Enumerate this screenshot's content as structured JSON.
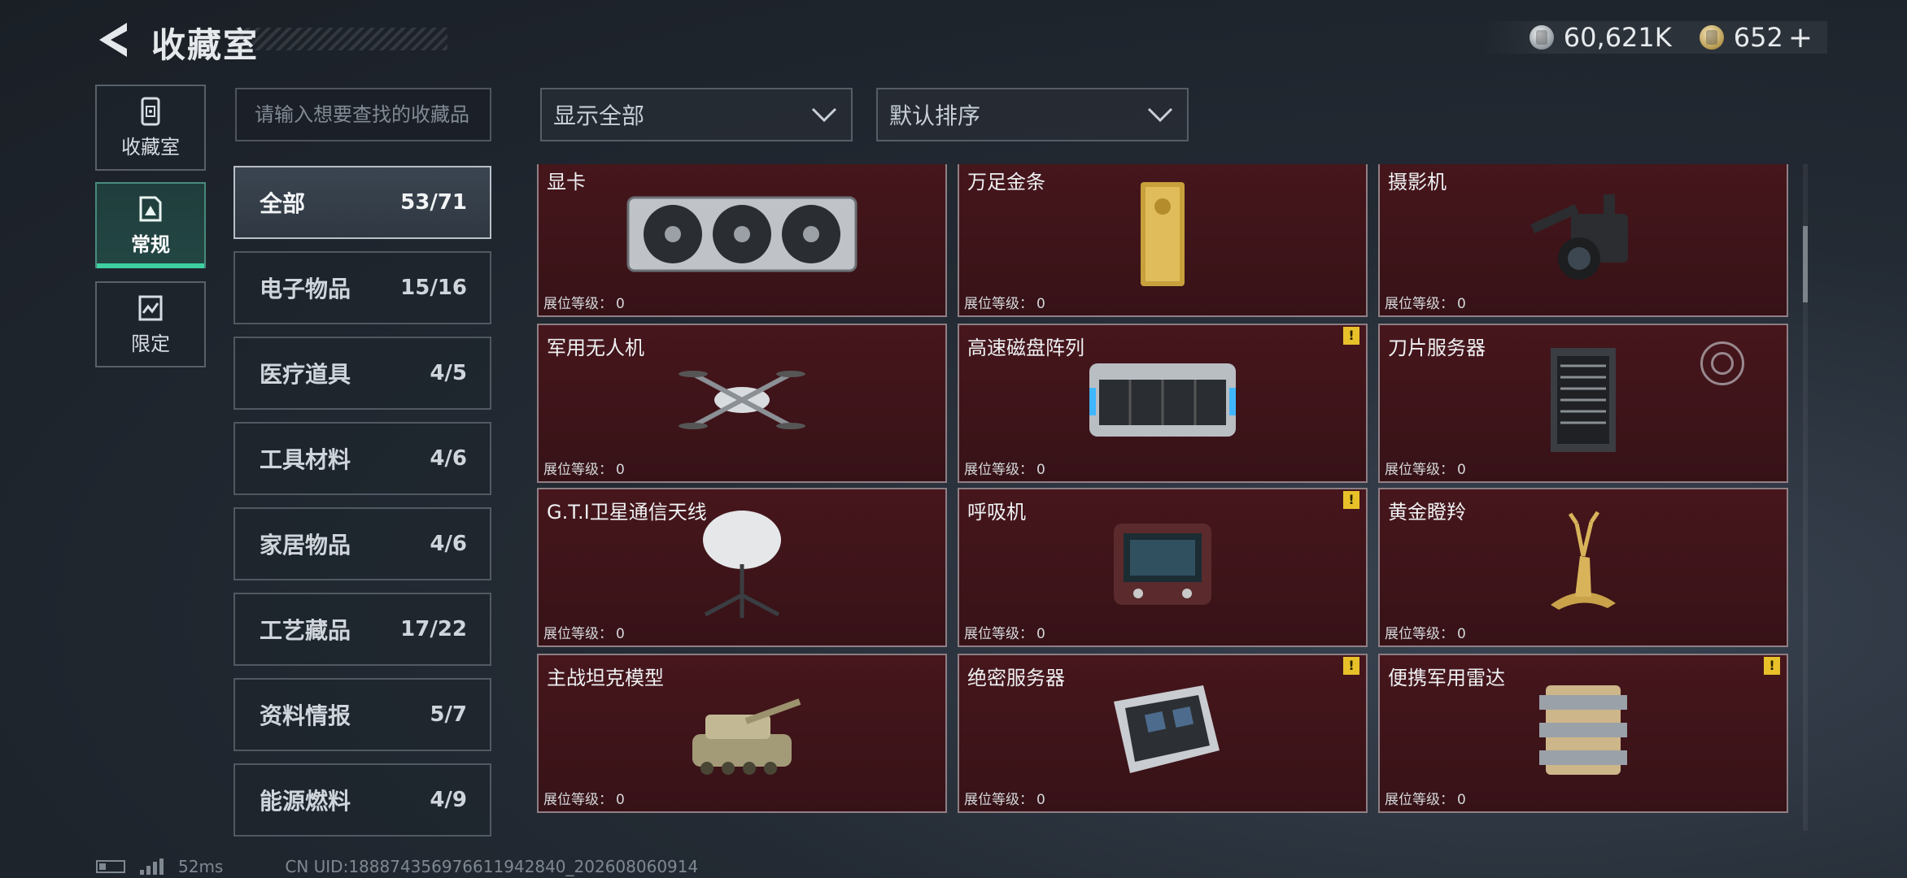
{
  "header": {
    "title": "收藏室",
    "currency_silver": "60,621K",
    "currency_gold": "652",
    "plus": "+"
  },
  "rail": [
    {
      "label": "收藏室",
      "icon": "collection-room-icon"
    },
    {
      "label": "常规",
      "icon": "regular-icon"
    },
    {
      "label": "限定",
      "icon": "limited-icon"
    }
  ],
  "search": {
    "placeholder": "请输入想要查找的收藏品"
  },
  "categories": [
    {
      "label": "全部",
      "count": "53/71"
    },
    {
      "label": "电子物品",
      "count": "15/16"
    },
    {
      "label": "医疗道具",
      "count": "4/5"
    },
    {
      "label": "工具材料",
      "count": "4/6"
    },
    {
      "label": "家居物品",
      "count": "4/6"
    },
    {
      "label": "工艺藏品",
      "count": "17/22"
    },
    {
      "label": "资料情报",
      "count": "5/7"
    },
    {
      "label": "能源燃料",
      "count": "4/9"
    }
  ],
  "filters": {
    "show": "显示全部",
    "sort": "默认排序"
  },
  "level_label": "展位等级：",
  "items": [
    {
      "name": "显卡",
      "level": "0",
      "warn": false,
      "icon": "graphics-card-icon"
    },
    {
      "name": "万足金条",
      "level": "0",
      "warn": false,
      "icon": "gold-bar-icon"
    },
    {
      "name": "摄影机",
      "level": "0",
      "warn": false,
      "icon": "camera-icon"
    },
    {
      "name": "军用无人机",
      "level": "0",
      "warn": false,
      "icon": "drone-icon"
    },
    {
      "name": "高速磁盘阵列",
      "level": "0",
      "warn": true,
      "icon": "disk-array-icon"
    },
    {
      "name": "刀片服务器",
      "level": "0",
      "warn": false,
      "icon": "blade-server-icon"
    },
    {
      "name": "G.T.I卫星通信天线",
      "level": "0",
      "warn": false,
      "icon": "satellite-antenna-icon"
    },
    {
      "name": "呼吸机",
      "level": "0",
      "warn": true,
      "icon": "ventilator-icon"
    },
    {
      "name": "黄金瞪羚",
      "level": "0",
      "warn": false,
      "icon": "gold-gazelle-icon"
    },
    {
      "name": "主战坦克模型",
      "level": "0",
      "warn": false,
      "icon": "tank-model-icon"
    },
    {
      "name": "绝密服务器",
      "level": "0",
      "warn": true,
      "icon": "secret-server-icon"
    },
    {
      "name": "便携军用雷达",
      "level": "0",
      "warn": true,
      "icon": "portable-radar-icon"
    }
  ],
  "warn_mark": "!",
  "footer": {
    "ping": "52ms",
    "uid": "CN UID:1888743569766119428​40_202608060914"
  }
}
